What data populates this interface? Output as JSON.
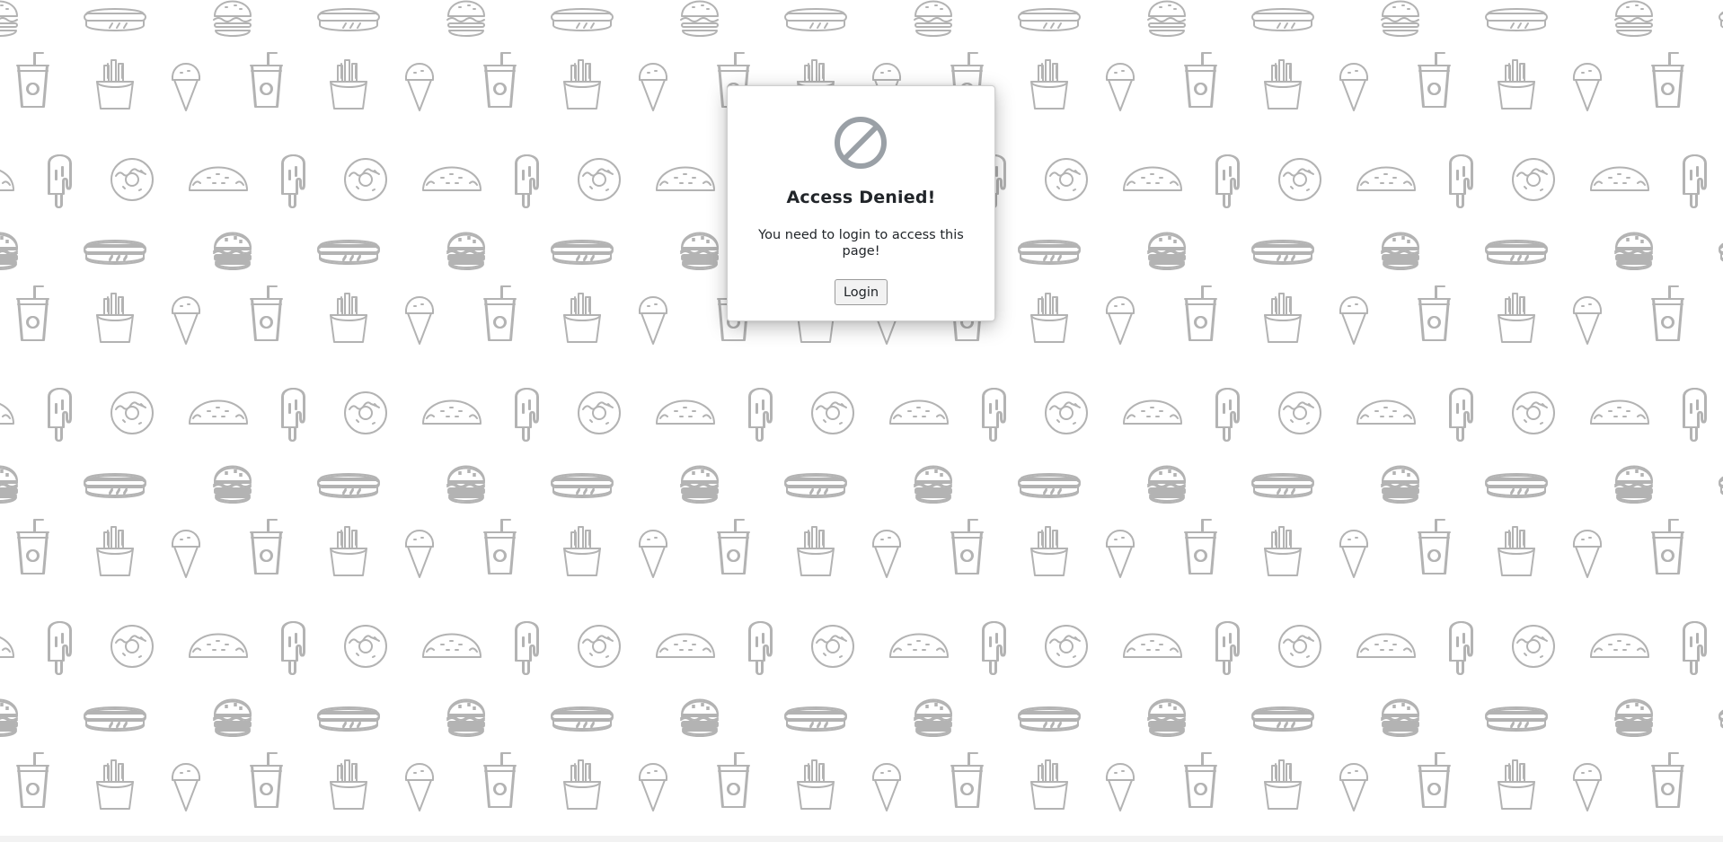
{
  "background": {
    "pattern_icons": [
      "hotdog-icon",
      "burger-icon",
      "soda-cup-icon",
      "fries-icon",
      "ice-cream-cone-icon",
      "popsicle-icon",
      "donut-icon",
      "taco-icon"
    ],
    "icon_color": "#b3b3b3",
    "page_color": "#ffffff"
  },
  "dialog": {
    "icon": "no-entry-icon",
    "icon_color": "#9aa0a6",
    "title": "Access Denied!",
    "message": "You need to login to access this page!",
    "login_label": "Login"
  }
}
